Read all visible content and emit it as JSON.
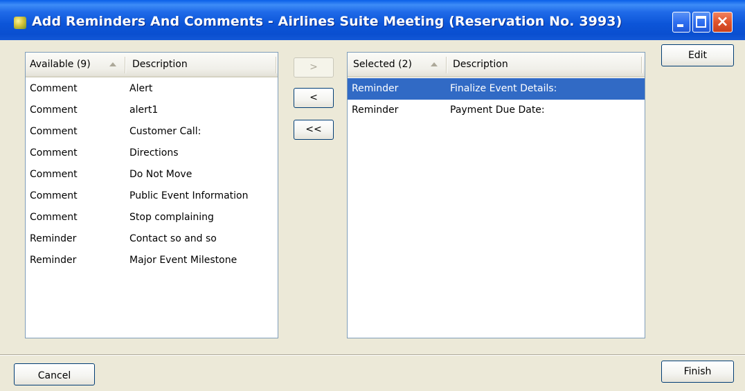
{
  "window": {
    "title": "Add Reminders And Comments - Airlines Suite Meeting (Reservation No. 3993)",
    "minimize_label": "",
    "close_label": "×"
  },
  "available": {
    "header_col1": "Available (9)",
    "header_col2": "Description",
    "rows": [
      {
        "type": "Comment",
        "description": "Alert"
      },
      {
        "type": "Comment",
        "description": "alert1"
      },
      {
        "type": "Comment",
        "description": "Customer Call:"
      },
      {
        "type": "Comment",
        "description": "Directions"
      },
      {
        "type": "Comment",
        "description": "Do Not Move"
      },
      {
        "type": "Comment",
        "description": "Public Event Information"
      },
      {
        "type": "Comment",
        "description": "Stop complaining"
      },
      {
        "type": "Reminder",
        "description": "Contact so and so"
      },
      {
        "type": "Reminder",
        "description": "Major Event Milestone"
      }
    ]
  },
  "selected": {
    "header_col1": "Selected (2)",
    "header_col2": "Description",
    "rows": [
      {
        "type": "Reminder",
        "description": "Finalize Event Details:",
        "highlighted": true
      },
      {
        "type": "Reminder",
        "description": "Payment Due Date:",
        "highlighted": false
      }
    ]
  },
  "buttons": {
    "move_right": ">",
    "move_left": "<",
    "move_all_left": "<<",
    "edit": "Edit",
    "cancel": "Cancel",
    "finish": "Finish"
  },
  "colors": {
    "selection": "#316ac5",
    "titlebar": "#0a4fd0",
    "dialog_bg": "#ece9d8"
  }
}
